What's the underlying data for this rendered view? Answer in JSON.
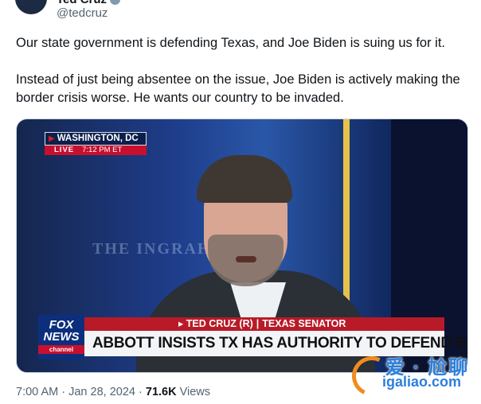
{
  "author": {
    "display_name": "Ted Cruz",
    "handle": "@tedcruz",
    "verified_icon": "verified-badge-icon"
  },
  "tweet": {
    "paragraphs": [
      "Our state government is defending Texas, and Joe Biden is suing us for it.",
      "Instead of just being absentee on the issue, Joe Biden is actively making the border crisis worse. He wants our country to be invaded."
    ]
  },
  "media": {
    "location": "WASHINGTON, DC",
    "live": "LIVE",
    "time": "7:12 PM ET",
    "background_text": "THE INGRAHAM",
    "network_logo": [
      "FOX",
      "NEWS",
      "channel"
    ],
    "subtitle_name": "TED CRUZ (R)",
    "subtitle_separator": "|",
    "subtitle_title": "TEXAS SENATOR",
    "headline": "ABBOTT INSISTS TX HAS AUTHORITY TO DEFEND BORDER"
  },
  "meta": {
    "time": "7:00 AM",
    "separator": "·",
    "date": "Jan 28, 2024",
    "views_count": "71.6K",
    "views_label": "Views"
  },
  "watermark": {
    "chars": "爱 · 尬聊",
    "url": "igaliao.com"
  },
  "colors": {
    "text_primary": "#0f1419",
    "text_secondary": "#536471",
    "fox_red": "#b81b27",
    "fox_blue": "#0c2f7d"
  }
}
